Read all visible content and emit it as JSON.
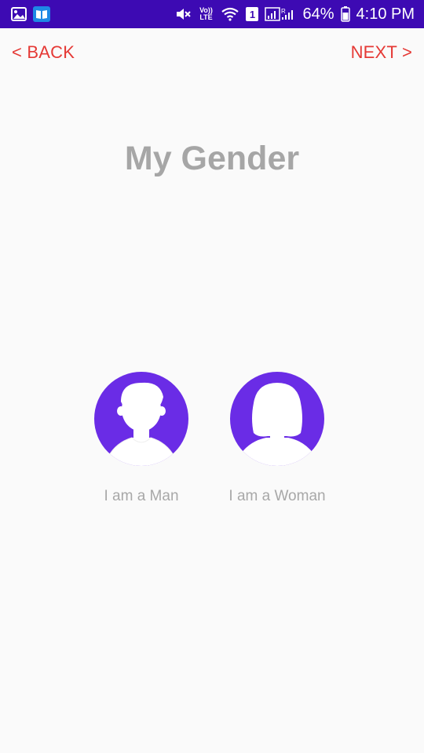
{
  "status_bar": {
    "percent": "64%",
    "time": "4:10 PM",
    "volte": "Vo)) LTE",
    "sim": "1",
    "icons": [
      "gallery-icon",
      "book-app-icon",
      "mute-icon",
      "wifi-icon",
      "signal-icon",
      "battery-icon"
    ],
    "bg_color": "#3d0ab3"
  },
  "nav": {
    "back_label": "< BACK",
    "next_label": "NEXT >",
    "link_color": "#e53935"
  },
  "page": {
    "title": "My Gender"
  },
  "options": {
    "man_label": "I am a Man",
    "woman_label": "I am a Woman",
    "avatar_color": "#6a2ce6"
  }
}
